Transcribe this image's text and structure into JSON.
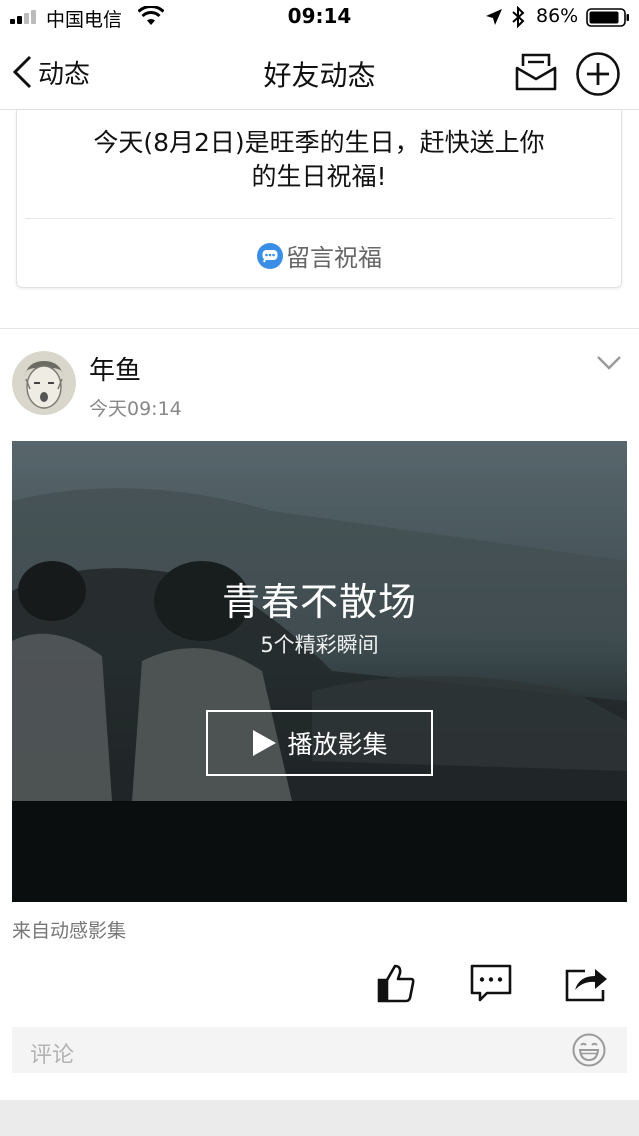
{
  "status_bar": {
    "carrier": "中国电信",
    "time": "09:14",
    "battery": "86%",
    "icons": [
      "signal-icon",
      "wifi-icon",
      "location-icon",
      "bluetooth-icon",
      "battery-icon"
    ]
  },
  "nav": {
    "back_label": "动态",
    "title": "好友动态",
    "icons": [
      "back-chevron-icon",
      "message-inbox-icon",
      "add-circle-icon"
    ]
  },
  "birthday_card": {
    "line1": "今天(8月2日)是旺季的生日，赶快送上你",
    "line2": "的生日祝福!",
    "action_label": "留言祝福",
    "action_icon": "chat-bubble-icon",
    "accent": "#3a8ee6"
  },
  "post": {
    "username": "年鱼",
    "time": "今天09:14",
    "album": {
      "title": "青春不散场",
      "subtitle": "5个精彩瞬间",
      "play_label": "播放影集",
      "play_icon": "play-icon"
    },
    "source": "来自动感影集",
    "actions": [
      "thumbs-up-icon",
      "comment-icon",
      "share-icon"
    ]
  },
  "comment_box": {
    "placeholder": "评论",
    "emoji_icon": "emoji-icon"
  }
}
